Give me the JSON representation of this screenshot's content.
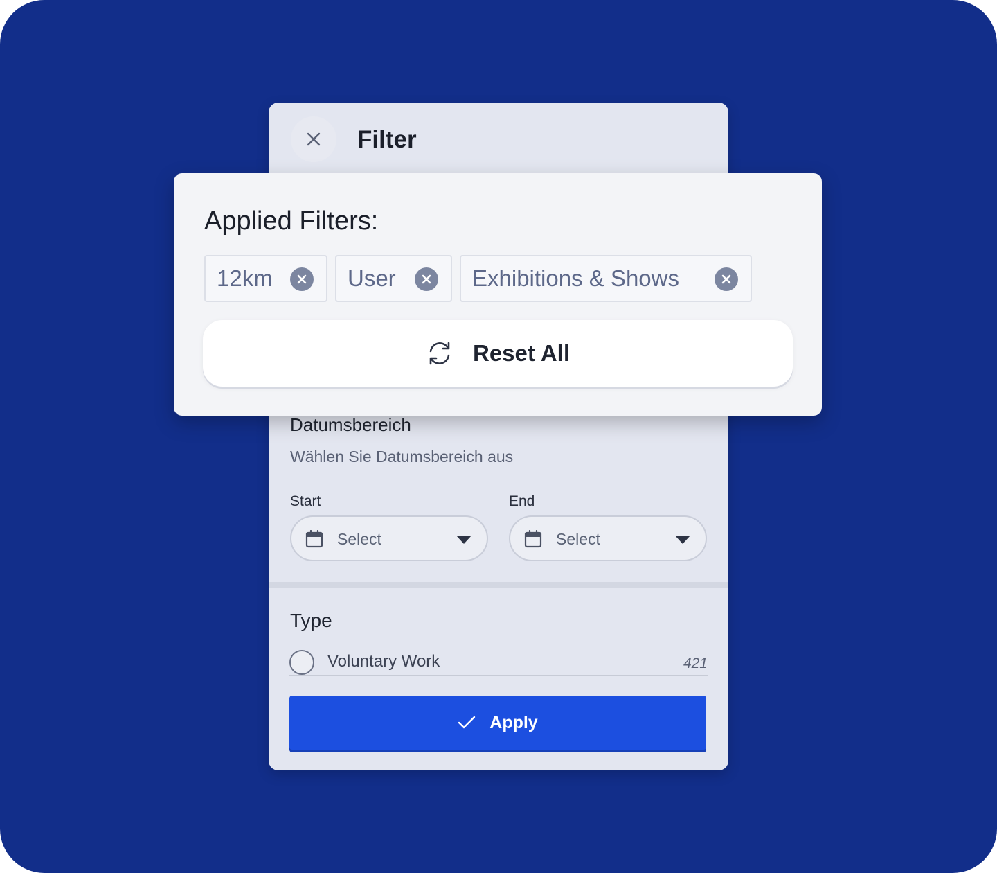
{
  "panel": {
    "title": "Filter",
    "date_range": {
      "title": "Datumsbereich",
      "subtitle": "Wählen Sie Datumsbereich aus",
      "start_label": "Start",
      "end_label": "End",
      "start_placeholder": "Select",
      "end_placeholder": "Select"
    },
    "type": {
      "title": "Type",
      "options": [
        {
          "label": "Voluntary Work",
          "count": "421"
        }
      ]
    },
    "apply_label": "Apply"
  },
  "applied_filters": {
    "title": "Applied Filters:",
    "chips": [
      {
        "label": "12km"
      },
      {
        "label": "User"
      },
      {
        "label": "Exhibitions & Shows"
      }
    ],
    "reset_label": "Reset All"
  },
  "colors": {
    "background": "#122e8a",
    "accent": "#1c4fe0",
    "panel": "#e3e6f0",
    "card": "#f3f4f7"
  },
  "icons": [
    "close-icon",
    "calendar-icon",
    "caret-down-icon",
    "check-icon",
    "refresh-icon",
    "chip-remove-icon"
  ]
}
